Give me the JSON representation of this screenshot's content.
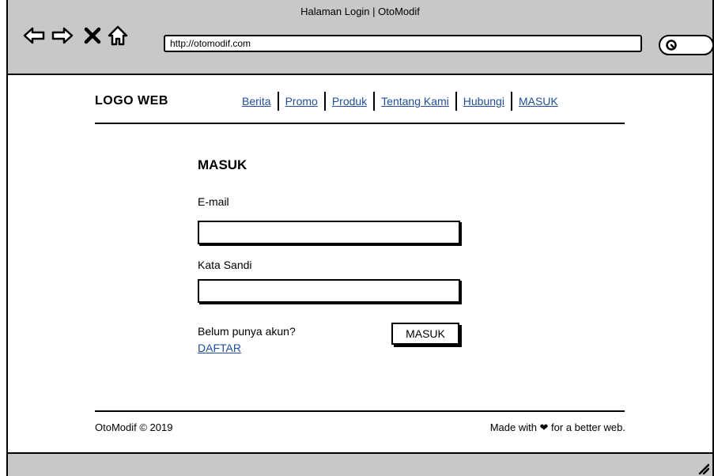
{
  "window": {
    "title": "Halaman Login | OtoModif",
    "url": "http://otomodif.com"
  },
  "icons": {
    "back": "back-arrow-icon",
    "forward": "forward-arrow-icon",
    "stop": "close-icon",
    "home": "home-icon",
    "search": "search-icon",
    "resize": "resize-grip-icon"
  },
  "header": {
    "logo": "LOGO WEB",
    "nav": [
      {
        "label": "Berita"
      },
      {
        "label": "Promo"
      },
      {
        "label": "Produk"
      },
      {
        "label": "Tentang Kami"
      },
      {
        "label": "Hubungi"
      },
      {
        "label": "MASUK"
      }
    ]
  },
  "login": {
    "title": "MASUK",
    "email_label": "E-mail",
    "email_value": "",
    "password_label": "Kata Sandi",
    "password_value": "",
    "no_account_text": "Belum punya akun?",
    "register_link": "DAFTAR",
    "submit_label": "MASUK"
  },
  "footer": {
    "copyright": "OtoModif © 2019",
    "made_with": "Made with ❤ for a better web."
  },
  "colors": {
    "chrome": "#c8c8c8",
    "link": "#1f4e9c"
  }
}
